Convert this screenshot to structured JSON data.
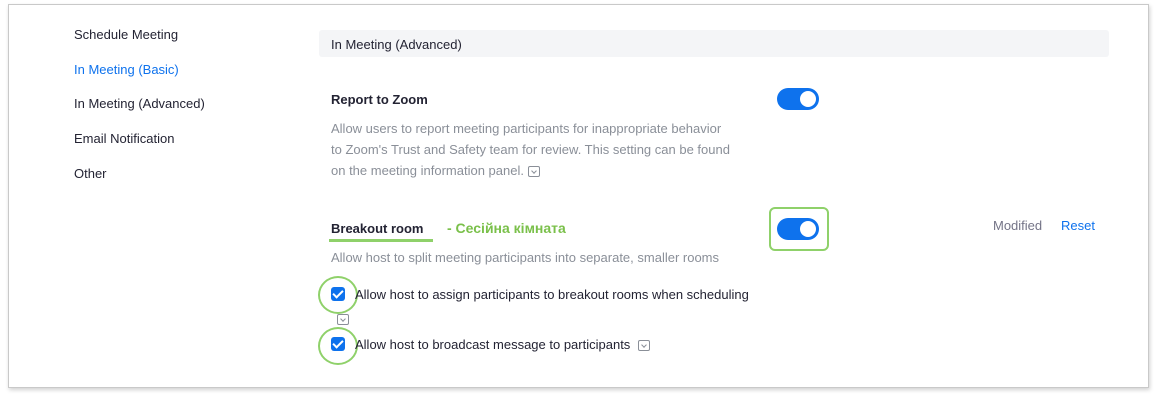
{
  "sidebar": {
    "items": [
      {
        "label": "Schedule Meeting",
        "active": false
      },
      {
        "label": "In Meeting (Basic)",
        "active": true
      },
      {
        "label": "In Meeting (Advanced)",
        "active": false
      },
      {
        "label": "Email Notification",
        "active": false
      },
      {
        "label": "Other",
        "active": false
      }
    ]
  },
  "section": {
    "title": "In Meeting (Advanced)"
  },
  "report_to_zoom": {
    "title": "Report to Zoom",
    "description_lines": [
      "Allow users to report meeting participants for inappropriate behavior",
      "to Zoom's Trust and Safety team for review. This setting can be found",
      "on the meeting information panel."
    ],
    "enabled": true
  },
  "breakout_room": {
    "title": "Breakout room",
    "annotation": "- Сесійна кімната",
    "description": "Allow host to split meeting participants into separate, smaller rooms",
    "enabled": true,
    "modified_label": "Modified",
    "reset_label": "Reset",
    "options": [
      {
        "label": "Allow host to assign participants to breakout rooms when scheduling",
        "checked": true
      },
      {
        "label": "Allow host to broadcast message to participants",
        "checked": true
      }
    ]
  },
  "colors": {
    "accent": "#0e72ed",
    "highlight": "#8fd16a",
    "annotation": "#7ac04a"
  }
}
